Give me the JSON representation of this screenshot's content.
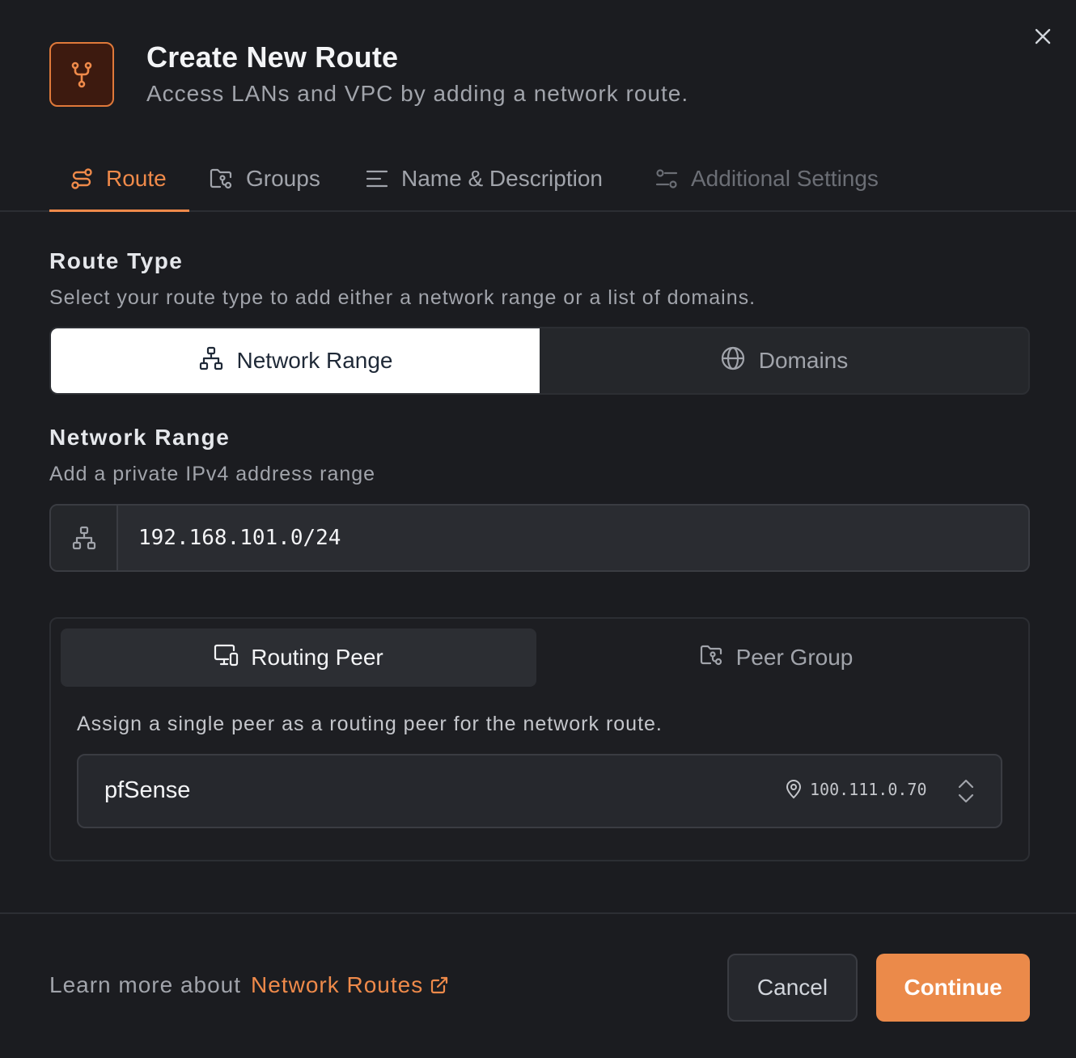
{
  "header": {
    "title": "Create New Route",
    "subtitle": "Access LANs and VPC by adding a network route.",
    "icon": "route-fork-icon",
    "close_icon": "close-icon"
  },
  "tabs": [
    {
      "label": "Route",
      "icon": "route-icon",
      "active": true
    },
    {
      "label": "Groups",
      "icon": "folder-group-icon",
      "active": false
    },
    {
      "label": "Name & Description",
      "icon": "text-lines-icon",
      "active": false
    },
    {
      "label": "Additional Settings",
      "icon": "settings-sliders-icon",
      "active": false,
      "disabled": true
    }
  ],
  "route_type": {
    "title": "Route Type",
    "description": "Select your route type to add either a network range or a list of domains.",
    "options": [
      {
        "label": "Network Range",
        "icon": "network-icon",
        "selected": true
      },
      {
        "label": "Domains",
        "icon": "globe-icon",
        "selected": false
      }
    ]
  },
  "network_range": {
    "title": "Network Range",
    "description": "Add a private IPv4 address range",
    "value": "192.168.101.0/24",
    "icon": "network-icon"
  },
  "peer": {
    "tabs": [
      {
        "label": "Routing Peer",
        "icon": "device-icon",
        "selected": true
      },
      {
        "label": "Peer Group",
        "icon": "folder-group-icon",
        "selected": false
      }
    ],
    "description": "Assign a single peer as a routing peer for the network route.",
    "selected_name": "pfSense",
    "selected_ip": "100.111.0.70"
  },
  "footer": {
    "learn_prefix": "Learn more about",
    "learn_link": "Network Routes",
    "cancel_label": "Cancel",
    "continue_label": "Continue"
  },
  "colors": {
    "accent": "#ef8a4a",
    "background": "#1b1c20",
    "continue_button": "#eb8a4a"
  }
}
